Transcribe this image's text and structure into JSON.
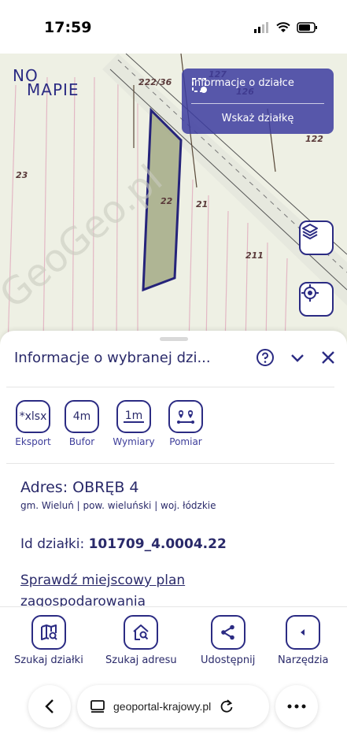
{
  "status": {
    "time": "17:59"
  },
  "map": {
    "logo_line1": "NO",
    "logo_line2": "MAPIE",
    "info_box": {
      "title": "Informacje o działce",
      "action": "Wskaż działkę"
    },
    "parcel_labels": [
      "222/36",
      "127",
      "126",
      "122",
      "23",
      "22",
      "21",
      "211"
    ],
    "watermark": "GeoGeo.pl"
  },
  "sheet": {
    "title": "Informacje o wybranej dzi...",
    "tools": [
      {
        "box": "*xlsx",
        "label": "Eksport"
      },
      {
        "box": "4m",
        "label": "Bufor"
      },
      {
        "box": "1m",
        "label": "Wymiary"
      },
      {
        "box": "",
        "label": "Pomiar"
      }
    ],
    "address": "Adres: OBRĘB 4",
    "address_sub": "gm. Wieluń | pow. wieluński | woj. łódzkie",
    "parcel_id_label": "Id działki: ",
    "parcel_id_value": "101709_4.0004.22",
    "plan_link": "Sprawdź miejscowy plan zagospodarowania"
  },
  "nav": [
    {
      "label": "Szukaj działki",
      "icon": "map-search-icon"
    },
    {
      "label": "Szukaj adresu",
      "icon": "home-search-icon"
    },
    {
      "label": "Udostępnij",
      "icon": "share-icon"
    },
    {
      "label": "Narzędzia",
      "icon": "chevron-left-icon"
    }
  ],
  "browser": {
    "url": "geoportal-krajowy.pl"
  },
  "colors": {
    "primary": "#2b2b83",
    "parcel_fill": "#9aa27a",
    "info_box": "#3c3ca0"
  }
}
